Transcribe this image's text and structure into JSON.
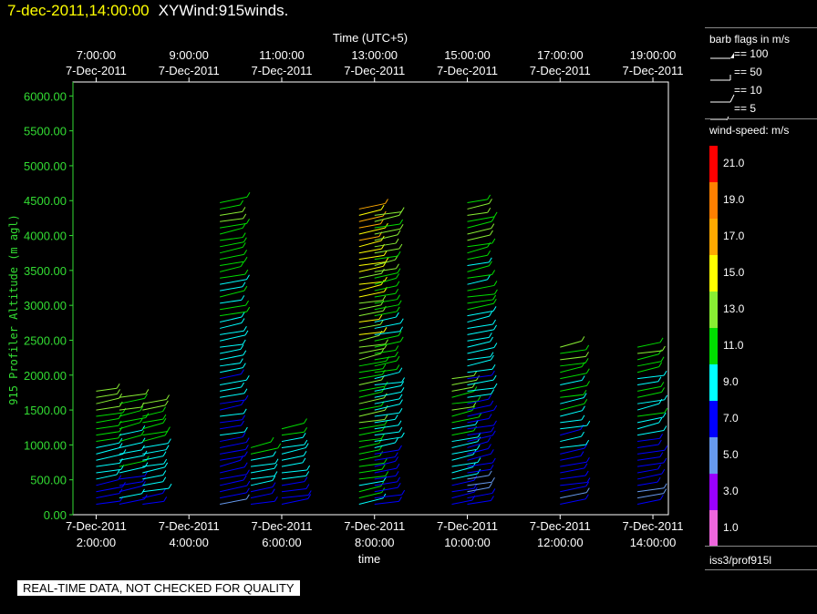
{
  "header": {
    "time": "7-dec-2011,14:00:00",
    "name": "XYWind:915winds."
  },
  "colors": {
    "plot_border": "#ffffff",
    "y_axis": "#33dd33",
    "title_time": "#ffff00"
  },
  "qc_banner": "REAL-TIME DATA, NOT CHECKED FOR QUALITY",
  "legend": {
    "barb_title": "barb flags in m/s",
    "barb_items": [
      "== 100",
      "== 50",
      "== 10",
      "== 5"
    ],
    "speed_title": "wind-speed: m/s",
    "colorbar": [
      {
        "label": "21.0",
        "color": "#ff0000"
      },
      {
        "label": "19.0",
        "color": "#ff8000"
      },
      {
        "label": "17.0",
        "color": "#ffaa00"
      },
      {
        "label": "15.0",
        "color": "#ffff00"
      },
      {
        "label": "13.0",
        "color": "#88ee33"
      },
      {
        "label": "11.0",
        "color": "#00dd00"
      },
      {
        "label": "9.0",
        "color": "#00ffff"
      },
      {
        "label": "7.0",
        "color": "#0000ff"
      },
      {
        "label": "5.0",
        "color": "#6699ee"
      },
      {
        "label": "3.0",
        "color": "#9900ff"
      },
      {
        "label": "1.0",
        "color": "#ee66dd"
      }
    ],
    "source": "iss3/prof915l"
  },
  "chart_data": {
    "type": "scatter",
    "title": "",
    "top_axis_label": "Time (UTC+5)",
    "xlabel": "time",
    "ylabel": "915 Profiler Altitude (m agl)",
    "xlim": [
      "2011-12-07 01:30",
      "2011-12-07 14:20"
    ],
    "ylim": [
      0,
      6200
    ],
    "grid": false,
    "x_ticks_bottom": [
      {
        "date": "7-Dec-2011",
        "time": "2:00:00"
      },
      {
        "date": "7-Dec-2011",
        "time": "4:00:00"
      },
      {
        "date": "7-Dec-2011",
        "time": "6:00:00"
      },
      {
        "date": "7-Dec-2011",
        "time": "8:00:00"
      },
      {
        "date": "7-Dec-2011",
        "time": "10:00:00"
      },
      {
        "date": "7-Dec-2011",
        "time": "12:00:00"
      },
      {
        "date": "7-Dec-2011",
        "time": "14:00:00"
      }
    ],
    "x_ticks_top": [
      {
        "time": "7:00:00",
        "date": "7-Dec-2011"
      },
      {
        "time": "9:00:00",
        "date": "7-Dec-2011"
      },
      {
        "time": "11:00:00",
        "date": "7-Dec-2011"
      },
      {
        "time": "13:00:00",
        "date": "7-Dec-2011"
      },
      {
        "time": "15:00:00",
        "date": "7-Dec-2011"
      },
      {
        "time": "17:00:00",
        "date": "7-Dec-2011"
      },
      {
        "time": "19:00:00",
        "date": "7-Dec-2011"
      }
    ],
    "y_ticks": [
      "0.00",
      "500.00",
      "1000.00",
      "1500.00",
      "2000.00",
      "2500.00",
      "3000.00",
      "3500.00",
      "4000.00",
      "4500.00",
      "5000.00",
      "5500.00",
      "6000.00"
    ],
    "series": [
      {
        "time": "2:00",
        "min_alt": 150,
        "max_alt": 1850,
        "speed": 9
      },
      {
        "time": "2:30",
        "min_alt": 150,
        "max_alt": 1700,
        "speed": 9
      },
      {
        "time": "3:00",
        "min_alt": 150,
        "max_alt": 1600,
        "speed": 9
      },
      {
        "time": "4:40",
        "min_alt": 150,
        "max_alt": 4500,
        "speed": 8
      },
      {
        "time": "5:20",
        "min_alt": 150,
        "max_alt": 1000,
        "speed": 8
      },
      {
        "time": "6:00",
        "min_alt": 150,
        "max_alt": 1300,
        "speed": 8
      },
      {
        "time": "7:40",
        "min_alt": 150,
        "max_alt": 4450,
        "speed": 12
      },
      {
        "time": "8:00",
        "min_alt": 150,
        "max_alt": 4300,
        "speed": 9
      },
      {
        "time": "9:40",
        "min_alt": 150,
        "max_alt": 2000,
        "speed": 9
      },
      {
        "time": "10:00",
        "min_alt": 150,
        "max_alt": 4500,
        "speed": 8
      },
      {
        "time": "12:00",
        "min_alt": 150,
        "max_alt": 2400,
        "speed": 8
      },
      {
        "time": "13:40",
        "min_alt": 150,
        "max_alt": 2400,
        "speed": 8
      }
    ]
  }
}
